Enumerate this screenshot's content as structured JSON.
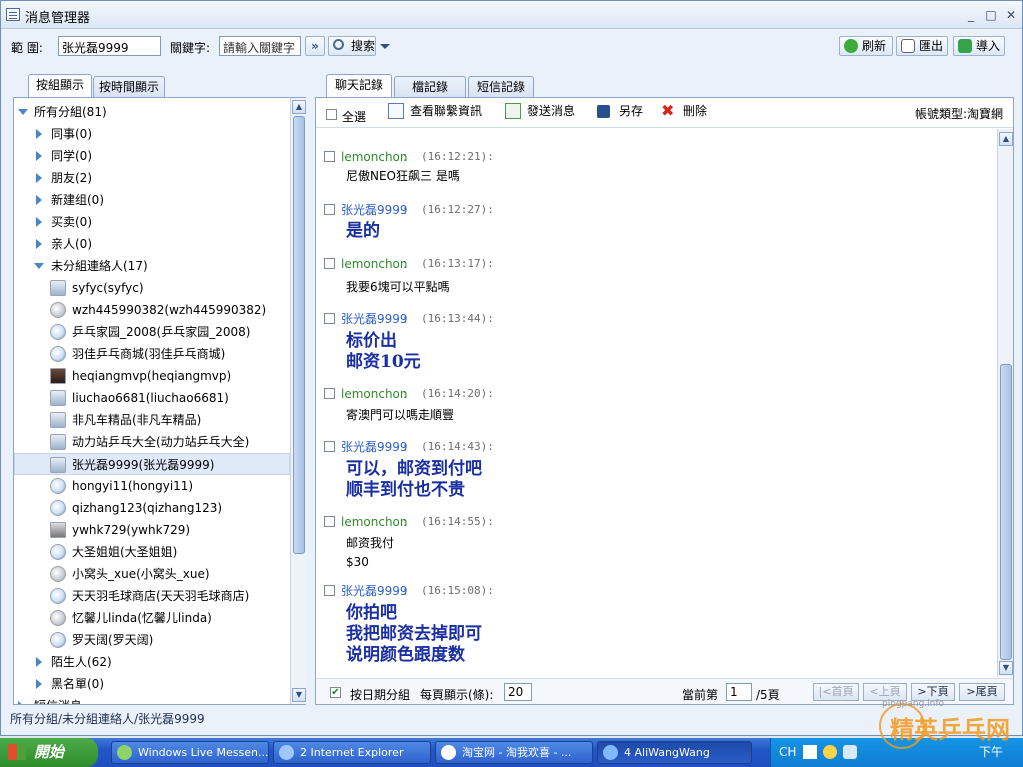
{
  "window": {
    "title": "消息管理器",
    "controls": [
      "_",
      "□",
      "✕"
    ]
  },
  "toolbar": {
    "range_label": "範 圍:",
    "range_value": "张光磊9999",
    "keyword_label": "關鍵字:",
    "keyword_placeholder": "請輸入關鍵字",
    "more_glyph": "»",
    "search_label": "搜索",
    "refresh_label": "刷新",
    "export_label": "匯出",
    "import_label": "導入"
  },
  "left_tabs": [
    "按組顯示",
    "按時間顯示"
  ],
  "tree": {
    "root": "所有分組(81)",
    "groups": [
      "同事(0)",
      "同学(0)",
      "朋友(2)",
      "新建组(0)",
      "买卖(0)",
      "亲人(0)"
    ],
    "ungrouped": "未分組連絡人(17)",
    "contacts": [
      {
        "name": "syfyc(syfyc)",
        "icon": "mobile-icon"
      },
      {
        "name": "wzh445990382(wzh445990382)",
        "icon": "offline-icon"
      },
      {
        "name": "乒乓家园_2008(乒乓家园_2008)",
        "icon": "qq-icon"
      },
      {
        "name": "羽佳乒乓商城(羽佳乒乓商城)",
        "icon": "qq-icon"
      },
      {
        "name": "heqiangmvp(heqiangmvp)",
        "icon": "photo-icon"
      },
      {
        "name": "liuchao6681(liuchao6681)",
        "icon": "mobile-icon"
      },
      {
        "name": "非凡车精品(非凡车精品)",
        "icon": "mobile-icon"
      },
      {
        "name": "动力站乒乓大全(动力站乒乓大全)",
        "icon": "mobile-icon"
      },
      {
        "name": "张光磊9999(张光磊9999)",
        "icon": "mobile-icon"
      },
      {
        "name": "hongyi11(hongyi11)",
        "icon": "qq-icon"
      },
      {
        "name": "qizhang123(qizhang123)",
        "icon": "qq-icon"
      },
      {
        "name": "ywhk729(ywhk729)",
        "icon": "photo-icon"
      },
      {
        "name": "大圣姐姐(大圣姐姐)",
        "icon": "qq-icon"
      },
      {
        "name": "小窝头_xue(小窝头_xue)",
        "icon": "offline-icon"
      },
      {
        "name": "天天羽毛球商店(天天羽毛球商店)",
        "icon": "qq-icon"
      },
      {
        "name": "忆馨儿linda(忆馨儿linda)",
        "icon": "offline-icon"
      },
      {
        "name": "罗天阔(罗天阔)",
        "icon": "qq-icon"
      }
    ],
    "strangers": "陌生人(62)",
    "blacklist": "黑名單(0)",
    "sms": "短信消息"
  },
  "right_tabs": [
    "聊天記錄",
    "檔記錄",
    "短信記錄"
  ],
  "msgbar": {
    "select_all": "全選",
    "view_contact": "查看聯繫資訊",
    "send_message": "發送消息",
    "save_as": "另存",
    "delete": "刪除",
    "account_type": "帳號類型:淘寶網"
  },
  "messages": [
    {
      "sender": "lemonchon",
      "time": "(16:12:21):",
      "me": false,
      "lines": [
        "尼傲NEO狂飙三 是嗎"
      ]
    },
    {
      "sender": "张光磊9999",
      "time": "(16:12:27):",
      "me": true,
      "lines": [
        "是的"
      ]
    },
    {
      "sender": "lemonchon",
      "time": "(16:13:17):",
      "me": false,
      "lines": [
        "我要6塊可以平點嗎"
      ]
    },
    {
      "sender": "张光磊9999",
      "time": "(16:13:44):",
      "me": true,
      "lines": [
        "标价出",
        "邮资10元"
      ]
    },
    {
      "sender": "lemonchon",
      "time": "(16:14:20):",
      "me": false,
      "lines": [
        "寄澳門可以嗎走順豐"
      ]
    },
    {
      "sender": "张光磊9999",
      "time": "(16:14:43):",
      "me": true,
      "lines": [
        "可以，邮资到付吧",
        "顺丰到付也不贵"
      ]
    },
    {
      "sender": "lemonchon",
      "time": "(16:14:55):",
      "me": false,
      "lines": [
        "邮资我付",
        "$30"
      ]
    },
    {
      "sender": "张光磊9999",
      "time": "(16:15:08):",
      "me": true,
      "lines": [
        "你拍吧",
        "我把邮资去掉即可",
        "说明颜色跟度数"
      ]
    }
  ],
  "footer": {
    "by_date": "按日期分組",
    "per_page_label": "每頁顯示(條):",
    "per_page_value": "20",
    "current_label": "當前第",
    "current_value": "1",
    "page_suffix": "/5頁",
    "first": "|<首頁",
    "prev": "<上頁",
    "next": ">下頁",
    "last": ">尾頁"
  },
  "status": "所有分組/未分組連絡人/张光磊9999",
  "taskbar": {
    "start": "開始",
    "tasks": [
      "Windows Live Messen...",
      "2 Internet Explorer",
      "淘宝网 - 淘我欢喜 - ...",
      "4 AliWangWang"
    ],
    "tray_lang": "CH",
    "clock": "下午"
  },
  "watermark": {
    "text": "精英乒乓网",
    "url": "pingpang.info"
  }
}
